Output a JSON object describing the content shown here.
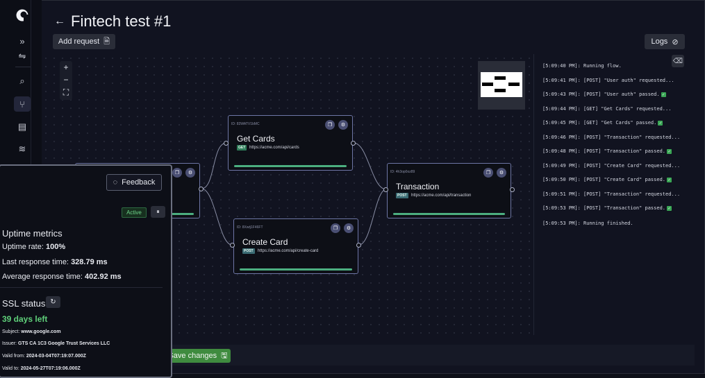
{
  "header": {
    "title": "Fintech test #1",
    "add_request_label": "Add request",
    "logs_label": "Logs"
  },
  "zoom": {
    "in": "+",
    "out": "−",
    "fit": "⛶"
  },
  "nodes": [
    {
      "id_text": "ID: 83WATV1bMC",
      "name": "Get Cards",
      "method": "GET",
      "url": "https://acme.com/api/cards"
    },
    {
      "id_text": "ID: 4h3op0oz89",
      "name": "Transaction",
      "method": "POST",
      "url": "https://acme.com/api/transaction"
    },
    {
      "id_text": "ID: 8Xwtj1F46FT",
      "name": "Create Card",
      "method": "POST",
      "url": "https://acme.com/api/create-card"
    }
  ],
  "logs": [
    {
      "text": "[5:09:40 PM]: Running flow.",
      "check": false
    },
    {
      "text": "[5:09:41 PM]: [POST] \"User auth\" requested...",
      "check": false
    },
    {
      "text": "[5:09:43 PM]: [POST] \"User auth\" passed.",
      "check": true
    },
    {
      "text": "[5:09:44 PM]: [GET] \"Get Cards\" requested...",
      "check": false
    },
    {
      "text": "[5:09:45 PM]: [GET] \"Get Cards\" passed.",
      "check": true
    },
    {
      "text": "[5:09:46 PM]: [POST] \"Transaction\" requested...",
      "check": false
    },
    {
      "text": "[5:09:48 PM]: [POST] \"Transaction\" passed.",
      "check": true
    },
    {
      "text": "[5:09:49 PM]: [POST] \"Create Card\" requested...",
      "check": false
    },
    {
      "text": "[5:09:50 PM]: [POST] \"Create Card\" passed.",
      "check": true
    },
    {
      "text": "[5:09:51 PM]: [POST] \"Transaction\" requested...",
      "check": false
    },
    {
      "text": "[5:09:53 PM]: [POST] \"Transaction\" passed.",
      "check": true
    },
    {
      "text": "[5:09:53 PM]: Running finished.",
      "check": false
    }
  ],
  "save_label": "Save changes",
  "monitor": {
    "feedback_label": "Feedback",
    "status_badge": "Active",
    "pause_icon": "⏸",
    "uptime_heading": "Uptime metrics",
    "uptime_rate_label": "Uptime rate:",
    "uptime_rate_value": "100%",
    "last_response_label": "Last response time:",
    "last_response_value": "328.79 ms",
    "avg_response_label": "Average response time:",
    "avg_response_value": "402.92 ms",
    "ssl_heading": "SSL status",
    "days_left": "39 days left",
    "subject_label": "Subject:",
    "subject_value": "www.google.com",
    "issuer_label": "Issuer:",
    "issuer_value": "GTS CA 1C3 Google Trust Services LLC",
    "valid_from_label": "Valid from:",
    "valid_from_value": "2024-03-04T07:19:07.000Z",
    "valid_to_label": "Valid to:",
    "valid_to_value": "2024-05-27T07:19:06.000Z"
  },
  "colors": {
    "accent_green": "#3f8b3f",
    "node_border": "#6e76a6",
    "background": "#111320"
  }
}
